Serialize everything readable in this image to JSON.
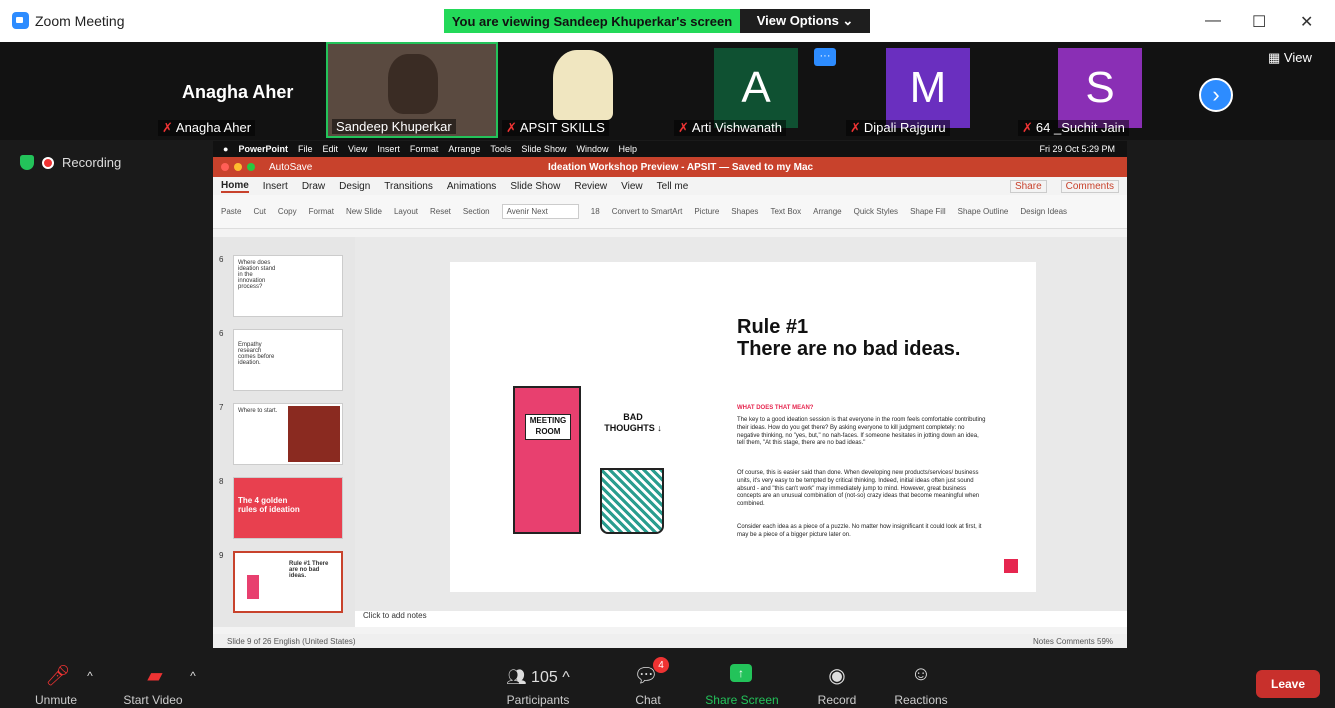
{
  "window": {
    "title": "Zoom Meeting",
    "minimize_icon": "—",
    "maximize_icon": "☐",
    "close_icon": "✕"
  },
  "banner": {
    "text": "You are viewing Sandeep Khuperkar's screen",
    "view_options": "View Options ⌄"
  },
  "participants_strip": {
    "featured_name": "Anagha Aher",
    "tiles": [
      {
        "name": "Anagha Aher",
        "muted": true
      },
      {
        "name": "Sandeep Khuperkar",
        "muted": false
      },
      {
        "name": "APSIT SKILLS",
        "muted": true
      },
      {
        "name": "Arti Vishwanath",
        "avatar_letter": "A",
        "color": "#0f5132",
        "muted": true
      },
      {
        "name": "Dipali Rajguru",
        "avatar_letter": "M",
        "color": "#6a2fbf",
        "muted": true
      },
      {
        "name": "64 _Suchit Jain",
        "avatar_letter": "S",
        "color": "#8a2fb5",
        "muted": true
      }
    ],
    "more_icon": "···",
    "view_label": "View",
    "next_icon": "›"
  },
  "recording": {
    "label": "Recording"
  },
  "shared_screen": {
    "mac_menu": [
      "PowerPoint",
      "File",
      "Edit",
      "View",
      "Insert",
      "Format",
      "Arrange",
      "Tools",
      "Slide Show",
      "Window",
      "Help"
    ],
    "clock": "Fri 29 Oct 5:29 PM",
    "autosave": "AutoSave",
    "doc_title": "Ideation Workshop Preview - APSIT — Saved to my Mac",
    "ribbon_tabs": [
      "Home",
      "Insert",
      "Draw",
      "Design",
      "Transitions",
      "Animations",
      "Slide Show",
      "Review",
      "View",
      "Tell me"
    ],
    "share_btn": "Share",
    "comments_btn": "Comments",
    "ribbon_items": [
      "Paste",
      "Cut",
      "Copy",
      "Format",
      "New Slide",
      "Layout",
      "Reset",
      "Section",
      "Avenir Next",
      "18",
      "Convert to SmartArt",
      "Picture",
      "Shapes",
      "Text Box",
      "Arrange",
      "Quick Styles",
      "Shape Fill",
      "Shape Outline",
      "Design Ideas"
    ],
    "thumbnails": [
      {
        "num": "6",
        "text": "Where does ideation stand in the innovation process?"
      },
      {
        "num": "6",
        "text": "Empathy research comes before ideation."
      },
      {
        "num": "7",
        "text": "Where to start."
      },
      {
        "num": "8",
        "text": "The 4 golden rules of ideation"
      },
      {
        "num": "9",
        "text": "Rule #1 There are no bad ideas."
      }
    ],
    "slide": {
      "title": "Rule #1\nThere are no bad ideas.",
      "question": "WHAT DOES THAT MEAN?",
      "p1": "The key to a good ideation session is that everyone in the room feels comfortable contributing their ideas. How do you get there? By asking everyone to kill judgment completely: no negative thinking, no \"yes, but,\" no nah-faces. If someone hesitates in jotting down an idea, tell them, \"At this stage, there are no bad ideas.\"",
      "p2": "Of course, this is easier said than done. When developing new products/services/ business units, it's very easy to be tempted by critical thinking. Indeed, initial ideas often just sound absurd - and \"this can't work\" may immediately jump to mind. However, great business concepts are an unusual combination of (not-so) crazy ideas that become meaningful when combined.",
      "p3": "Consider each idea as a piece of a puzzle. No matter how insignificant it could look at first, it may be a piece of a bigger picture later on.",
      "door_sign": "MEETING ROOM",
      "bin_label": "BAD THOUGHTS ↓"
    },
    "notes_placeholder": "Click to add notes",
    "status_left": "Slide 9 of 26    English (United States)",
    "status_right": "Notes   Comments   59%"
  },
  "toolbar": {
    "unmute": "Unmute",
    "start_video": "Start Video",
    "participants": "Participants",
    "participants_count": "105",
    "chat": "Chat",
    "chat_badge": "4",
    "share_screen": "Share Screen",
    "record": "Record",
    "reactions": "Reactions",
    "leave": "Leave"
  }
}
